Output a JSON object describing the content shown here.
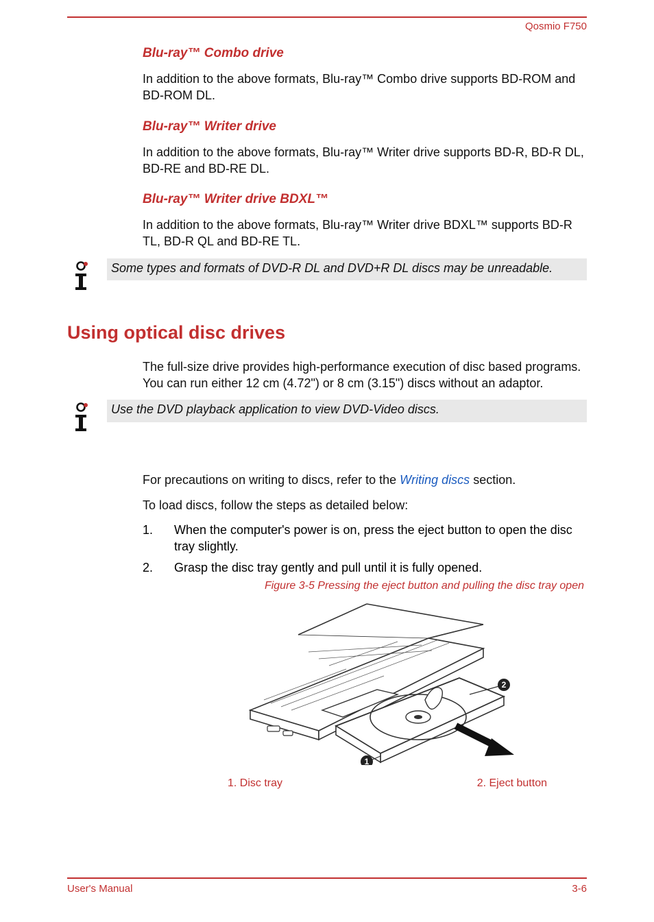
{
  "header": {
    "product": "Qosmio F750"
  },
  "sections": {
    "combo": {
      "heading": "Blu-ray™ Combo drive",
      "body": "In addition to the above formats, Blu-ray™ Combo drive supports BD-ROM and BD-ROM DL."
    },
    "writer": {
      "heading": "Blu-ray™ Writer drive",
      "body": "In addition to the above formats, Blu-ray™ Writer drive supports BD-R, BD-R DL, BD-RE and BD-RE DL."
    },
    "bdxl": {
      "heading": "Blu-ray™ Writer drive BDXL™",
      "body": "In addition to the above formats, Blu-ray™ Writer drive BDXL™ supports BD-R TL, BD-R QL and BD-RE TL."
    }
  },
  "notes": {
    "dvd_dl": "Some types and formats of DVD-R DL and DVD+R DL discs may be unreadable.",
    "playback": "Use the DVD playback application to view DVD-Video discs."
  },
  "using": {
    "heading": "Using optical disc drives",
    "intro": "The full-size drive provides high-performance execution of disc based programs. You can run either 12 cm (4.72\") or 8 cm (3.15\") discs without an adaptor.",
    "precaution_prefix": "For precautions on writing to discs, refer to the ",
    "precaution_link": "Writing discs",
    "precaution_suffix": " section.",
    "load_intro": "To load discs, follow the steps as detailed below:",
    "steps": [
      "When the computer's power is on, press the eject button to open the disc tray slightly.",
      "Grasp the disc tray gently and pull until it is fully opened."
    ],
    "figure_caption": "Figure 3-5 Pressing the eject button and pulling the disc tray open",
    "labels": {
      "tray": "1. Disc tray",
      "eject": "2. Eject button"
    }
  },
  "footer": {
    "left": "User's Manual",
    "right": "3-6"
  }
}
